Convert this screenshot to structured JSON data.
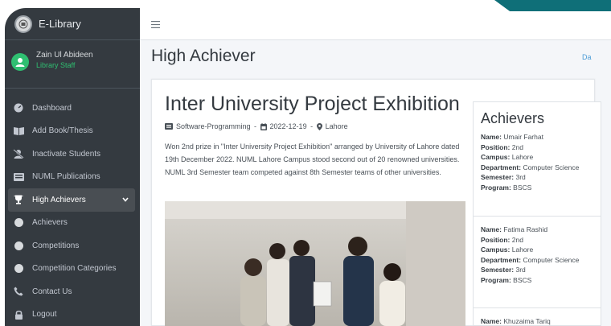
{
  "brand": {
    "name": "E-Library"
  },
  "user": {
    "name": "Zain Ul Abideen",
    "role": "Library Staff"
  },
  "sidebar": {
    "items": [
      {
        "label": "Dashboard",
        "icon": "dashboard-icon"
      },
      {
        "label": "Add Book/Thesis",
        "icon": "book-open-icon"
      },
      {
        "label": "Inactivate Students",
        "icon": "user-slash-icon"
      },
      {
        "label": "NUML Publications",
        "icon": "newspaper-icon"
      },
      {
        "label": "High Achievers",
        "icon": "trophy-icon",
        "active": true
      },
      {
        "label": "Achievers",
        "icon": "circle-icon"
      },
      {
        "label": "Competitions",
        "icon": "circle-icon"
      },
      {
        "label": "Competition Categories",
        "icon": "circle-icon"
      },
      {
        "label": "Contact Us",
        "icon": "phone-icon"
      },
      {
        "label": "Logout",
        "icon": "lock-icon"
      }
    ]
  },
  "header": {
    "title": "High Achiever",
    "breadcrumb": "Da"
  },
  "post": {
    "title": "Inter University Project Exhibition",
    "category": "Software-Programming",
    "date": "2022-12-19",
    "location": "Lahore",
    "description": "Won 2nd prize in \"Inter University Project Exhibition\" arranged by University of Lahore dated 19th December 2022. NUML Lahore Campus stood second out of 20 renowned universities. NUML 3rd Semester team competed against 8th Semester teams of other universities."
  },
  "achievers": {
    "title": "Achievers",
    "labels": {
      "name": "Name:",
      "position": "Position:",
      "campus": "Campus:",
      "department": "Department:",
      "semester": "Semester:",
      "program": "Program:"
    },
    "list": [
      {
        "name": "Umair Farhat",
        "position": "2nd",
        "campus": "Lahore",
        "department": "Computer Science",
        "semester": "3rd",
        "program": "BSCS"
      },
      {
        "name": "Fatima Rashid",
        "position": "2nd",
        "campus": "Lahore",
        "department": "Computer Science",
        "semester": "3rd",
        "program": "BSCS"
      },
      {
        "name": "Khuzaima Tariq"
      }
    ]
  },
  "colors": {
    "sidebar": "#343a40",
    "accent_green": "#2fbf71",
    "teal": "#0f6f78",
    "link": "#4a9bd6"
  }
}
